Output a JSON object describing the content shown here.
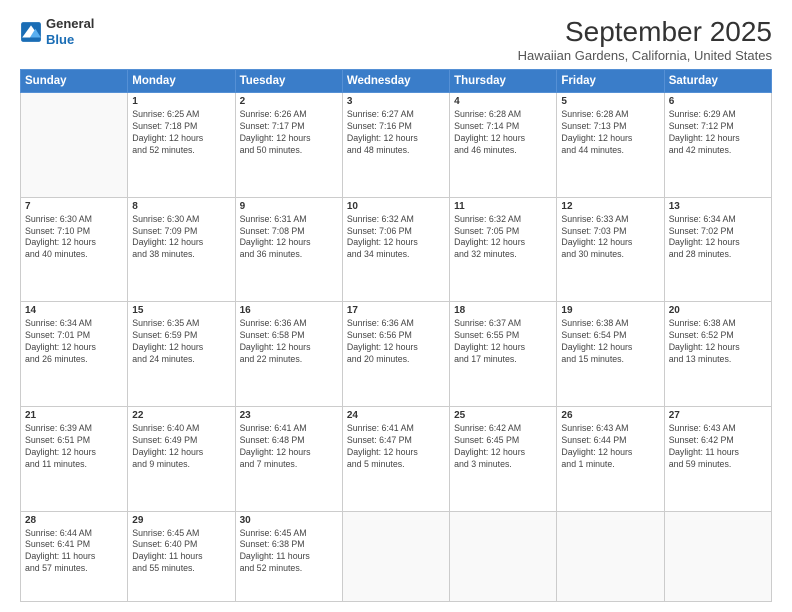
{
  "logo": {
    "general": "General",
    "blue": "Blue"
  },
  "header": {
    "title": "September 2025",
    "location": "Hawaiian Gardens, California, United States"
  },
  "weekdays": [
    "Sunday",
    "Monday",
    "Tuesday",
    "Wednesday",
    "Thursday",
    "Friday",
    "Saturday"
  ],
  "weeks": [
    [
      {
        "day": "",
        "text": ""
      },
      {
        "day": "1",
        "text": "Sunrise: 6:25 AM\nSunset: 7:18 PM\nDaylight: 12 hours\nand 52 minutes."
      },
      {
        "day": "2",
        "text": "Sunrise: 6:26 AM\nSunset: 7:17 PM\nDaylight: 12 hours\nand 50 minutes."
      },
      {
        "day": "3",
        "text": "Sunrise: 6:27 AM\nSunset: 7:16 PM\nDaylight: 12 hours\nand 48 minutes."
      },
      {
        "day": "4",
        "text": "Sunrise: 6:28 AM\nSunset: 7:14 PM\nDaylight: 12 hours\nand 46 minutes."
      },
      {
        "day": "5",
        "text": "Sunrise: 6:28 AM\nSunset: 7:13 PM\nDaylight: 12 hours\nand 44 minutes."
      },
      {
        "day": "6",
        "text": "Sunrise: 6:29 AM\nSunset: 7:12 PM\nDaylight: 12 hours\nand 42 minutes."
      }
    ],
    [
      {
        "day": "7",
        "text": "Sunrise: 6:30 AM\nSunset: 7:10 PM\nDaylight: 12 hours\nand 40 minutes."
      },
      {
        "day": "8",
        "text": "Sunrise: 6:30 AM\nSunset: 7:09 PM\nDaylight: 12 hours\nand 38 minutes."
      },
      {
        "day": "9",
        "text": "Sunrise: 6:31 AM\nSunset: 7:08 PM\nDaylight: 12 hours\nand 36 minutes."
      },
      {
        "day": "10",
        "text": "Sunrise: 6:32 AM\nSunset: 7:06 PM\nDaylight: 12 hours\nand 34 minutes."
      },
      {
        "day": "11",
        "text": "Sunrise: 6:32 AM\nSunset: 7:05 PM\nDaylight: 12 hours\nand 32 minutes."
      },
      {
        "day": "12",
        "text": "Sunrise: 6:33 AM\nSunset: 7:03 PM\nDaylight: 12 hours\nand 30 minutes."
      },
      {
        "day": "13",
        "text": "Sunrise: 6:34 AM\nSunset: 7:02 PM\nDaylight: 12 hours\nand 28 minutes."
      }
    ],
    [
      {
        "day": "14",
        "text": "Sunrise: 6:34 AM\nSunset: 7:01 PM\nDaylight: 12 hours\nand 26 minutes."
      },
      {
        "day": "15",
        "text": "Sunrise: 6:35 AM\nSunset: 6:59 PM\nDaylight: 12 hours\nand 24 minutes."
      },
      {
        "day": "16",
        "text": "Sunrise: 6:36 AM\nSunset: 6:58 PM\nDaylight: 12 hours\nand 22 minutes."
      },
      {
        "day": "17",
        "text": "Sunrise: 6:36 AM\nSunset: 6:56 PM\nDaylight: 12 hours\nand 20 minutes."
      },
      {
        "day": "18",
        "text": "Sunrise: 6:37 AM\nSunset: 6:55 PM\nDaylight: 12 hours\nand 17 minutes."
      },
      {
        "day": "19",
        "text": "Sunrise: 6:38 AM\nSunset: 6:54 PM\nDaylight: 12 hours\nand 15 minutes."
      },
      {
        "day": "20",
        "text": "Sunrise: 6:38 AM\nSunset: 6:52 PM\nDaylight: 12 hours\nand 13 minutes."
      }
    ],
    [
      {
        "day": "21",
        "text": "Sunrise: 6:39 AM\nSunset: 6:51 PM\nDaylight: 12 hours\nand 11 minutes."
      },
      {
        "day": "22",
        "text": "Sunrise: 6:40 AM\nSunset: 6:49 PM\nDaylight: 12 hours\nand 9 minutes."
      },
      {
        "day": "23",
        "text": "Sunrise: 6:41 AM\nSunset: 6:48 PM\nDaylight: 12 hours\nand 7 minutes."
      },
      {
        "day": "24",
        "text": "Sunrise: 6:41 AM\nSunset: 6:47 PM\nDaylight: 12 hours\nand 5 minutes."
      },
      {
        "day": "25",
        "text": "Sunrise: 6:42 AM\nSunset: 6:45 PM\nDaylight: 12 hours\nand 3 minutes."
      },
      {
        "day": "26",
        "text": "Sunrise: 6:43 AM\nSunset: 6:44 PM\nDaylight: 12 hours\nand 1 minute."
      },
      {
        "day": "27",
        "text": "Sunrise: 6:43 AM\nSunset: 6:42 PM\nDaylight: 11 hours\nand 59 minutes."
      }
    ],
    [
      {
        "day": "28",
        "text": "Sunrise: 6:44 AM\nSunset: 6:41 PM\nDaylight: 11 hours\nand 57 minutes."
      },
      {
        "day": "29",
        "text": "Sunrise: 6:45 AM\nSunset: 6:40 PM\nDaylight: 11 hours\nand 55 minutes."
      },
      {
        "day": "30",
        "text": "Sunrise: 6:45 AM\nSunset: 6:38 PM\nDaylight: 11 hours\nand 52 minutes."
      },
      {
        "day": "",
        "text": ""
      },
      {
        "day": "",
        "text": ""
      },
      {
        "day": "",
        "text": ""
      },
      {
        "day": "",
        "text": ""
      }
    ]
  ]
}
